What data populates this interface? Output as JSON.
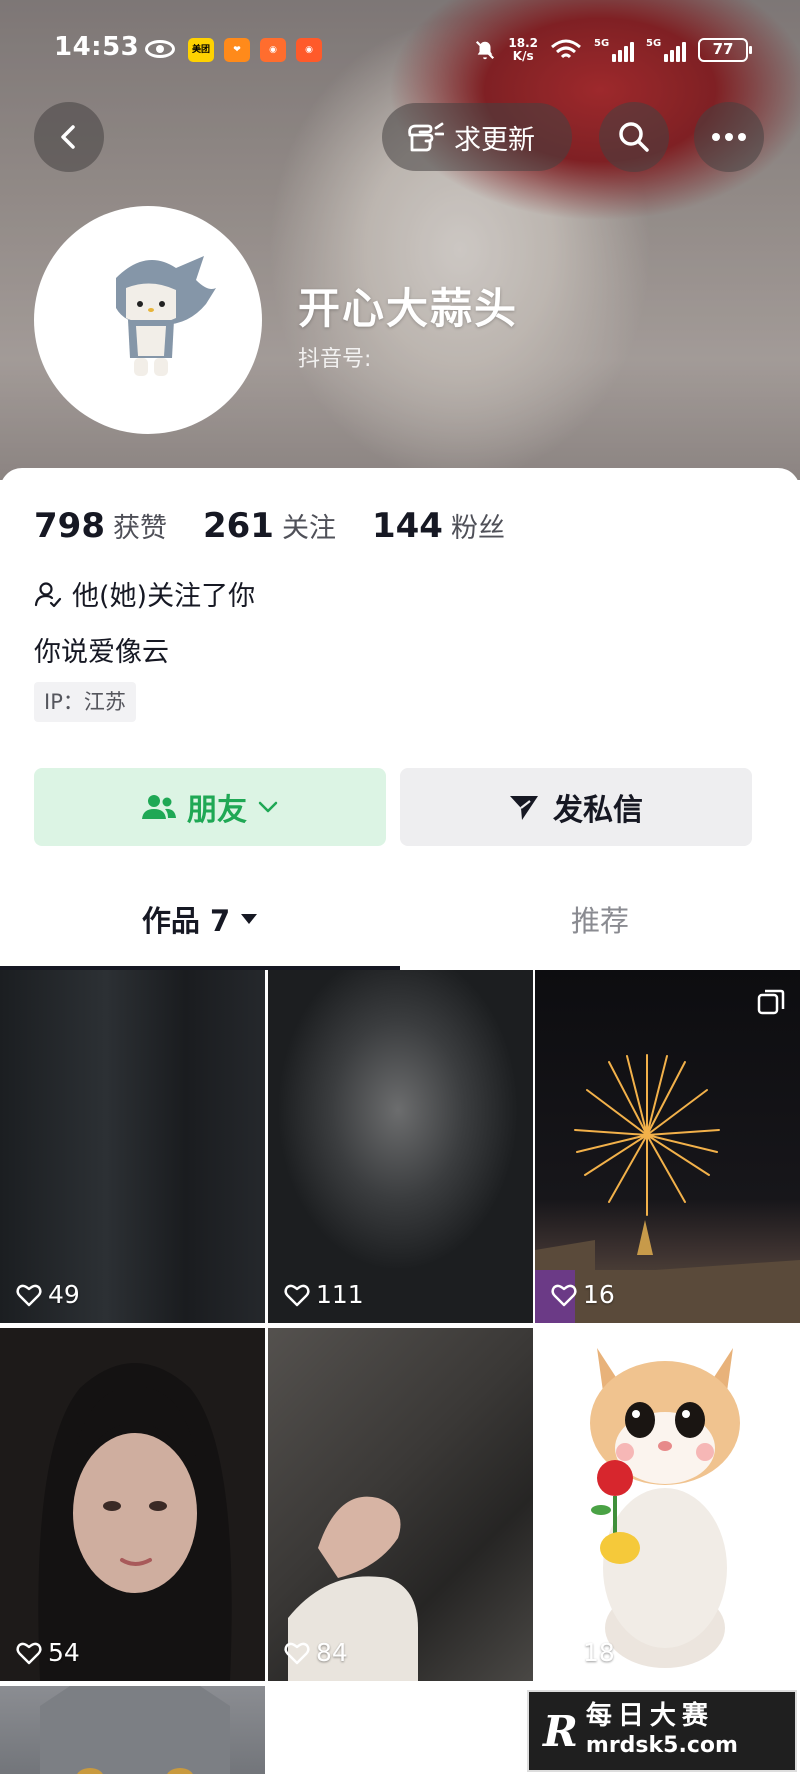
{
  "status_bar": {
    "time": "14:53",
    "net_speed_value": "18.2",
    "net_speed_unit": "K/s",
    "sig1": "5G",
    "sig2": "5G",
    "battery": "77",
    "app1_label": "美团"
  },
  "header": {
    "update_label": "求更新",
    "username": "开心大蒜头",
    "douyin_id_label": "抖音号:"
  },
  "profile": {
    "stats": [
      {
        "num": "798",
        "label": "获赞"
      },
      {
        "num": "261",
        "label": "关注"
      },
      {
        "num": "144",
        "label": "粉丝"
      }
    ],
    "follow_status": "他(她)关注了你",
    "bio": "你说爱像云",
    "ip": "IP：江苏"
  },
  "actions": {
    "friend_label": "朋友",
    "message_label": "发私信"
  },
  "tabs": {
    "works_label": "作品 7",
    "recommend_label": "推荐"
  },
  "grid": {
    "likes": [
      "49",
      "111",
      "16",
      "54",
      "84",
      "18"
    ]
  },
  "watermark": {
    "logo": "R",
    "line1": "每日大赛",
    "line2": "mrdsk5.com"
  },
  "colors": {
    "friend_green": "#1fa855",
    "friend_bg": "#dcf4e4",
    "text_primary": "#161823"
  }
}
